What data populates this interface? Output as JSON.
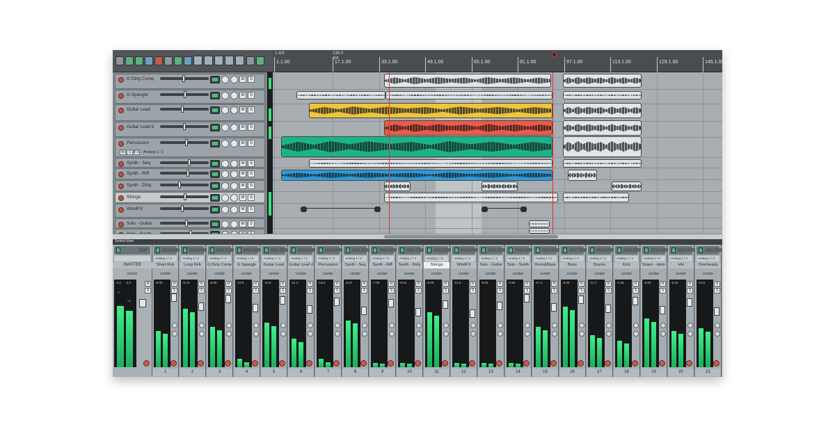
{
  "ruler": {
    "ticks": [
      "1.1.00",
      "17.1.00",
      "33.1.00",
      "49.1.00",
      "65.1.00",
      "81.1.00",
      "97.1.00",
      "113.1.00",
      "129.1.00",
      "145.1.00"
    ],
    "markers": [
      "1 4/4",
      "134.0",
      "4/4"
    ]
  },
  "tracks": [
    {
      "name": "G Dirty Comp"
    },
    {
      "name": "G Spangle"
    },
    {
      "name": "Guitar Lead"
    },
    {
      "name": "Guitar Lead d"
    },
    {
      "name": "Percussion",
      "sub": "Analog 1 / 2"
    },
    {
      "name": "Synth - Seq"
    },
    {
      "name": "Synth - Riff"
    },
    {
      "name": "Synth - Dirty"
    },
    {
      "name": "Strings"
    },
    {
      "name": "WindFX"
    },
    {
      "name": "Solo - Guitar"
    },
    {
      "name": "Solo - Synth"
    }
  ],
  "tcp_buttons": {
    "mute": "M",
    "solo": "S",
    "fx": "FX",
    "route": "ROUTE"
  },
  "status": {
    "mixer_label": "Select time"
  },
  "mixer": {
    "master": {
      "name": "MASTER",
      "pan": "center",
      "peaks": [
        "-4.2",
        "-4.2"
      ],
      "scale": [
        "-6",
        "-12",
        "-18",
        "-24",
        "-30",
        "-36",
        "-42",
        "-48",
        "-54"
      ]
    },
    "strips": [
      {
        "num": "1",
        "name": "Short Rvb",
        "pan": "center",
        "peak": "-9.00",
        "input": "Analog 1 / 2",
        "level": 0.45
      },
      {
        "num": "2",
        "name": "Long Rvb",
        "pan": "center",
        "peak": "-8.13",
        "input": "Analog 1 / 2",
        "level": 0.72
      },
      {
        "num": "3",
        "name": "G Dirty Comp",
        "pan": "center",
        "peak": "-9.80",
        "input": "Analog 1 / 2",
        "level": 0.5
      },
      {
        "num": "4",
        "name": "G Spangle",
        "pan": "center",
        "peak": "-12.0",
        "input": "Analog 1 / 2",
        "level": 0.1
      },
      {
        "num": "5",
        "name": "Guitar Lead",
        "pan": "center",
        "peak": "-12.5",
        "input": "Analog 1 / 2",
        "level": 0.55
      },
      {
        "num": "6",
        "name": "Guitar Lead d",
        "pan": "center",
        "peak": "-11.3",
        "input": "Analog 1 / 2",
        "level": 0.35
      },
      {
        "num": "7",
        "name": "Percussion",
        "pan": "center",
        "peak": "-16.4",
        "input": "Analog 1 / 2",
        "level": 0.1
      },
      {
        "num": "8",
        "name": "Synth - Seq",
        "pan": "center",
        "peak": "-8.57",
        "input": "Analog 1 / 2",
        "level": 0.58
      },
      {
        "num": "9",
        "name": "Synth - Riff",
        "pan": "center",
        "peak": "-7.00",
        "input": "Analog 1 / 2",
        "level": 0.05
      },
      {
        "num": "10",
        "name": "Synth - Dirty",
        "pan": "center",
        "peak": "-9.51",
        "input": "Analog 1 / 2",
        "level": 0.05
      },
      {
        "num": "11",
        "name": "Strings",
        "pan": "center",
        "peak": "-8.00",
        "input": "Analog 1 / 2",
        "level": 0.68,
        "selected": true
      },
      {
        "num": "12",
        "name": "WindFX",
        "pan": "center",
        "peak": "-12.6",
        "input": "Analog 1 / 2",
        "level": 0.05
      },
      {
        "num": "13",
        "name": "Solo - Guitar",
        "pan": "center",
        "peak": "-9.00",
        "input": "Analog 1 / 2",
        "level": 0.05
      },
      {
        "num": "14",
        "name": "Solo - Synth",
        "pan": "center",
        "peak": "-4.50",
        "input": "Analog 1 / 2",
        "level": 0.05
      },
      {
        "num": "15",
        "name": "Drum&Bass",
        "pan": "center",
        "peak": "-17.1",
        "input": "Analog 1 / 2",
        "level": 0.5
      },
      {
        "num": "16",
        "name": "Bass",
        "pan": "center",
        "peak": "-9.00",
        "input": "Analog 1 / 2",
        "level": 0.75
      },
      {
        "num": "17",
        "name": "Drums",
        "pan": "center",
        "peak": "-12.7",
        "input": "Analog 1 / 2",
        "level": 0.4
      },
      {
        "num": "18",
        "name": "Kick",
        "pan": "center",
        "peak": "-4.46",
        "input": "Analog 1 / 2",
        "level": 0.33
      },
      {
        "num": "19",
        "name": "Snare - stem",
        "pan": "center",
        "peak": "-9.00",
        "input": "Analog 1 / 2",
        "level": 0.6
      },
      {
        "num": "20",
        "name": "HH",
        "pan": "center",
        "peak": "-5.23",
        "input": "Analog 1 / 2",
        "level": 0.45
      },
      {
        "num": "21",
        "name": "Overheads",
        "pan": "center",
        "peak": "-9.01",
        "input": "Analog 1 / 2",
        "level": 0.48
      }
    ]
  }
}
